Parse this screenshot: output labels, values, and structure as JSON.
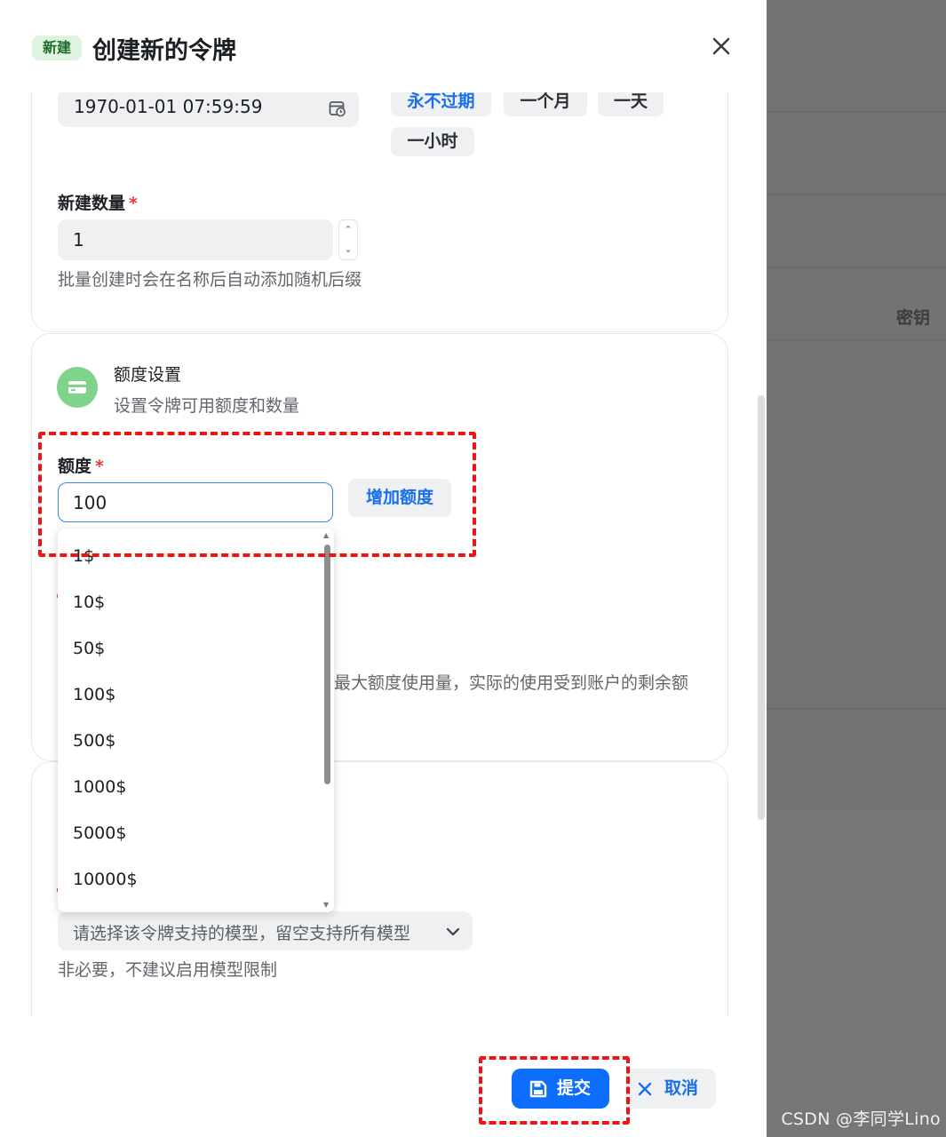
{
  "sheet": {
    "tag": "新建",
    "title": "创建新的令牌"
  },
  "expire": {
    "value": "1970-01-01 07:59:59",
    "quick": [
      "永不过期",
      "一个月",
      "一天",
      "一小时"
    ]
  },
  "count": {
    "label": "新建数量",
    "required": "*",
    "value": "1",
    "help": "批量创建时会在名称后自动添加随机后缀"
  },
  "quota_section": {
    "title": "额度设置",
    "subtitle": "设置令牌可用额度和数量",
    "label": "额度",
    "required": "*",
    "value": "100",
    "add_button": "增加额度",
    "help_partial": "最大额度使用量，实际的使用受到账户的剩余额"
  },
  "quota_options": [
    "1$",
    "10$",
    "50$",
    "100$",
    "500$",
    "1000$",
    "5000$",
    "10000$"
  ],
  "models": {
    "placeholder": "请选择该令牌支持的模型，留空支持所有模型",
    "help": "非必要，不建议启用模型限制"
  },
  "footer": {
    "submit": "提交",
    "cancel": "取消"
  },
  "background": {
    "column_label": "密钥",
    "watermark": "CSDN @李同学Lino"
  },
  "colors": {
    "primary": "#0d6efd",
    "link": "#1a6fe8",
    "annotation": "#ee1414",
    "tag_bg": "#dff3e0"
  }
}
